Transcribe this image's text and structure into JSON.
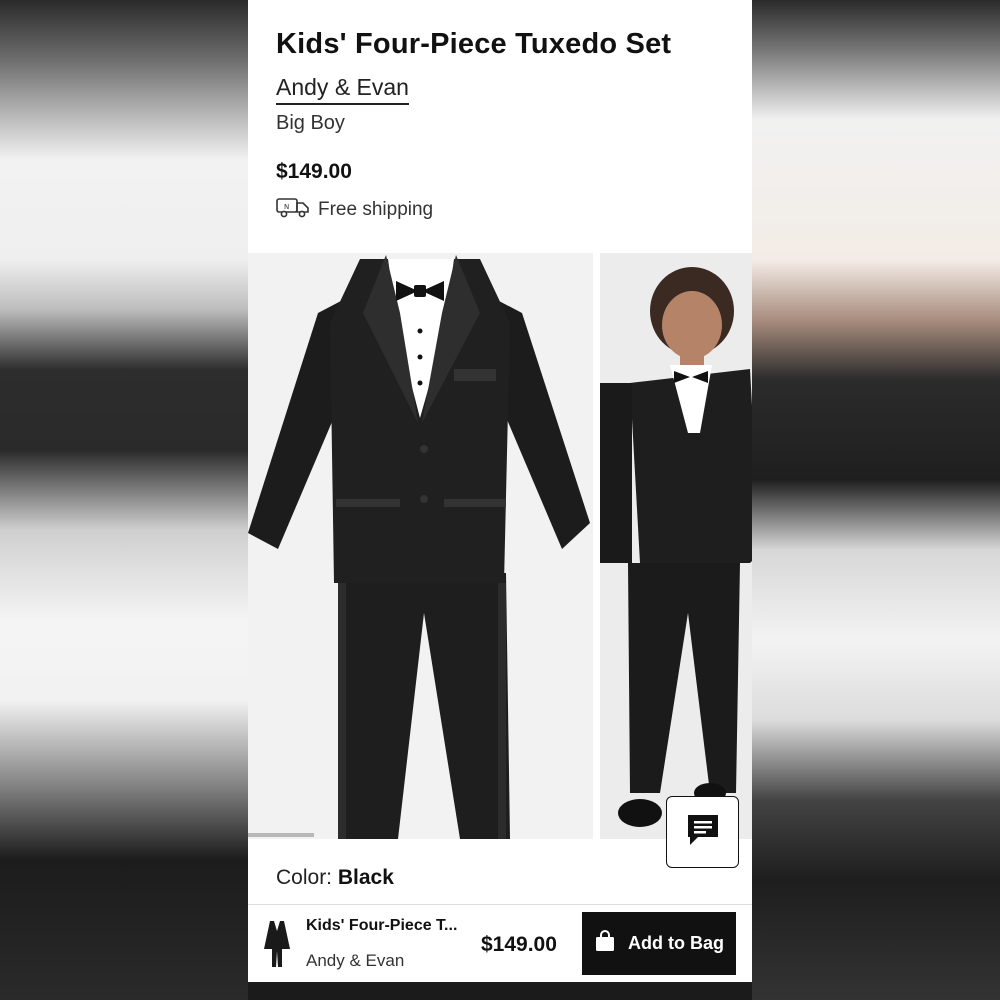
{
  "product": {
    "title": "Kids' Four-Piece Tuxedo Set",
    "brand": "Andy & Evan",
    "subcategory": "Big Boy",
    "price": "$149.00",
    "shipping_text": "Free shipping",
    "shipping_icon": "truck-icon",
    "color_label": "Color:",
    "color_value": "Black"
  },
  "gallery": {
    "images": [
      "tuxedo-flat-lay",
      "boy-wearing-tuxedo"
    ]
  },
  "chat": {
    "icon": "chat-icon"
  },
  "sticky_bar": {
    "title": "Kids' Four-Piece T...",
    "brand": "Andy & Evan",
    "price": "$149.00",
    "add_label": "Add to Bag",
    "add_icon": "shopping-bag-icon"
  },
  "colors": {
    "accent": "#111111",
    "background": "#ffffff"
  }
}
